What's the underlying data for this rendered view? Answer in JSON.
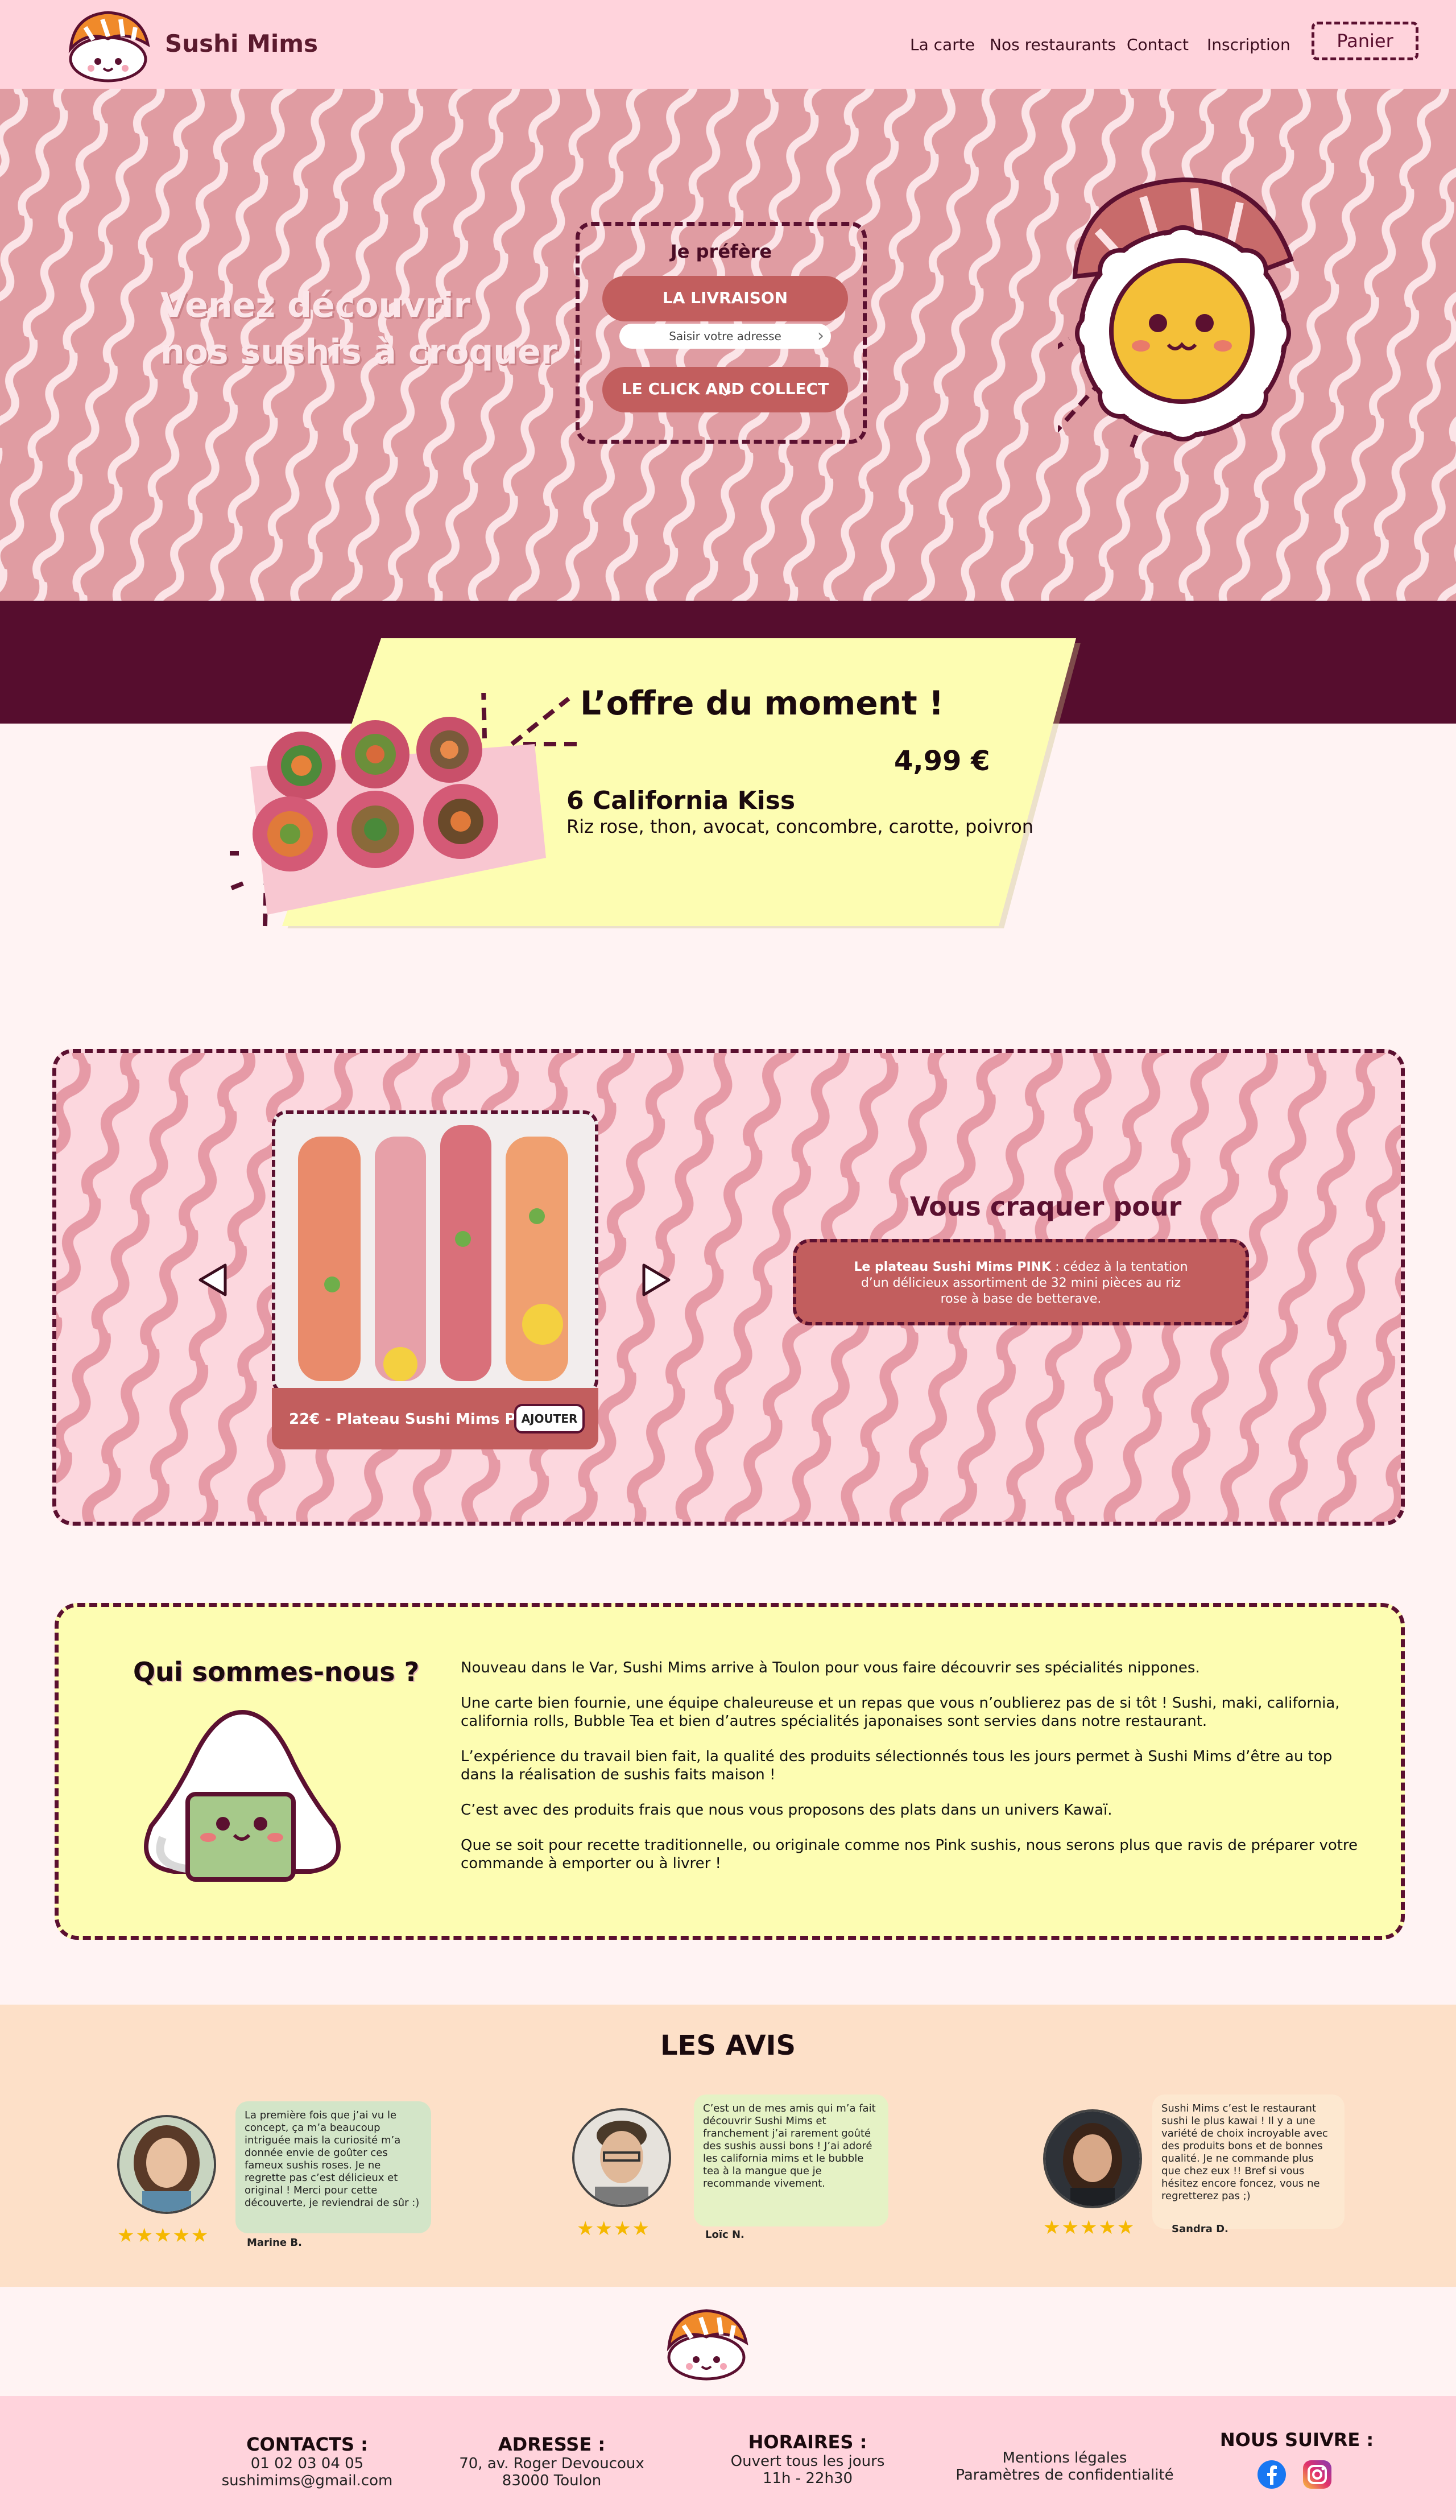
{
  "header": {
    "brand": "Sushi Mims",
    "nav": [
      "La carte",
      "Nos restaurants",
      "Contact",
      "Inscription"
    ],
    "basket": "Panier"
  },
  "hero": {
    "title_line1": "Venez découvrir",
    "title_line2": "nos sushis à croquer !",
    "prefer": "Je préfère",
    "delivery": "LA LIVRAISON",
    "address_placeholder": "Saisir votre adresse",
    "click_collect": "LE CLICK AND COLLECT"
  },
  "offer": {
    "title": "L’offre du moment !",
    "price": "4,99 €",
    "name": "6 California Kiss",
    "description": "Riz rose, thon, avocat, concombre, carotte, poivron"
  },
  "slider": {
    "caption": "22€ - Plateau Sushi Mims PINK",
    "add": "AJOUTER",
    "crave_title": "Vous craquer pour",
    "crave_text": "Le plateau Sushi Mims PINK : cédez à la tentation d’un délicieux assortiment de 32 mini pièces au riz rose à base de betterave.",
    "crave_strong": "Le plateau Sushi Mims PINK"
  },
  "about": {
    "title": "Qui sommes-nous ?",
    "paragraphs": [
      "Nouveau dans le Var, Sushi Mims arrive à Toulon pour vous faire découvrir ses spécialités nippones.",
      "Une carte bien fournie, une équipe chaleureuse et un repas que vous n’oublierez pas de si tôt ! Sushi, maki, california, california rolls, Bubble Tea et bien d’autres spécialités japonaises sont servies dans notre restaurant.",
      "L’expérience du travail bien fait, la qualité des produits sélectionnés tous les jours permet à Sushi Mims d’être au top dans la réalisation de sushis faits maison !",
      "C’est avec des produits frais que nous vous proposons des plats dans un univers Kawaï.",
      "Que se soit pour recette traditionnelle, ou originale comme nos Pink sushis, nous serons plus que ravis de préparer votre commande à emporter ou à livrer !"
    ]
  },
  "reviews": {
    "title": "LES AVIS",
    "items": [
      {
        "text": "La première fois que j’ai vu le concept, ça m’a beaucoup intriguée mais la curiosité m’a donnée envie de goûter ces fameux sushis roses. Je ne regrette pas c’est délicieux et original ! Merci pour cette découverte, je reviendrai de sûr :)",
        "author": "Marine B.",
        "stars": "★★★★★",
        "rating": 5
      },
      {
        "text": "C’est un de mes amis qui m’a fait découvrir Sushi Mims et franchement j’ai rarement goûté des sushis aussi bons ! J’ai adoré les california mims et le bubble tea à la mangue que je recommande vivement.",
        "author": "Loïc N.",
        "stars": "★★★★",
        "rating": 4
      },
      {
        "text": "Sushi Mims c’est le restaurant sushi le plus kawai ! Il y a une variété de choix incroyable avec des produits bons et de bonnes qualité. Je ne commande plus que chez eux !! Bref si vous hésitez encore foncez, vous ne regretterez pas ;)",
        "author": "Sandra D.",
        "stars": "★★★★★",
        "rating": 5
      }
    ]
  },
  "footer": {
    "contacts_title": "CONTACTS :",
    "phone": "01 02 03 04 05",
    "email": "sushimims@gmail.com",
    "address_title": "ADRESSE :",
    "address1": "70, av. Roger Devoucoux",
    "address2": "83000 Toulon",
    "hours_title": "HORAIRES :",
    "hours1": "Ouvert tous les jours",
    "hours2": "11h - 22h30",
    "legal": "Mentions légales",
    "privacy": "Paramètres de confidentialité",
    "follow": "NOUS SUIVRE :"
  },
  "colors": {
    "pink_bg": "#ffd3dc",
    "hero_pink": "#e09ca2",
    "plum": "#560d2e",
    "coral": "#c25e5e",
    "yellow": "#fdfdb2",
    "peach": "#fde0c8"
  }
}
